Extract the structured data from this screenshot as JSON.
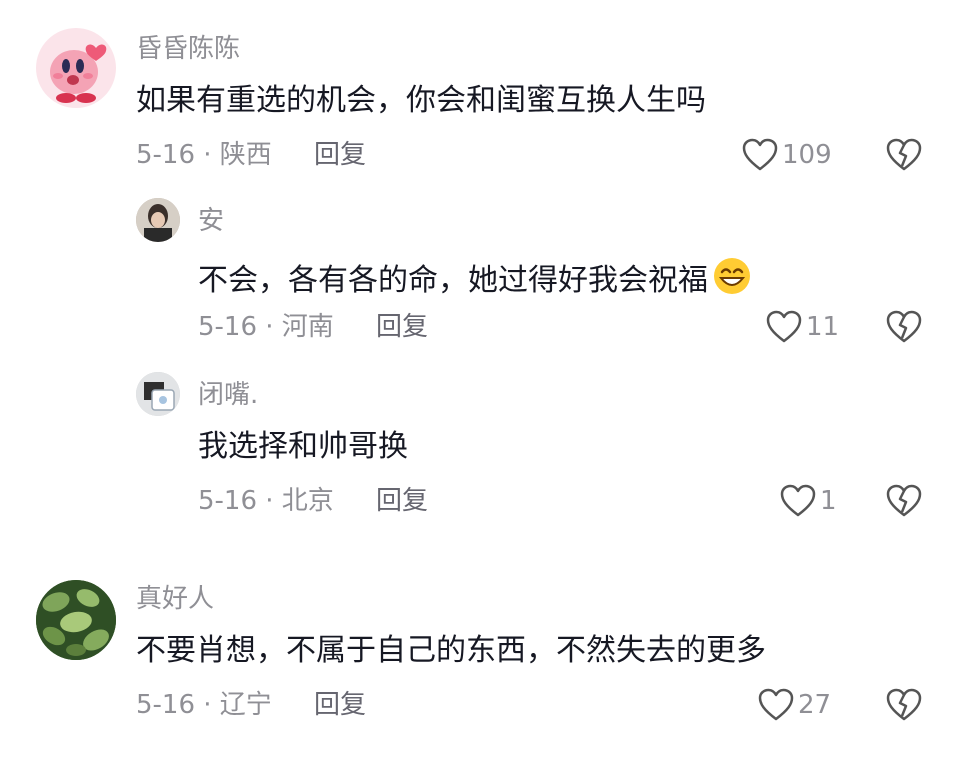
{
  "comments": [
    {
      "username": "昏昏陈陈",
      "text": "如果有重选的机会，你会和闺蜜互换人生吗",
      "date_location": "5-16 · 陕西",
      "reply_label": "回复",
      "likes": "109",
      "avatar_icon": "kirby-avatar-icon"
    },
    {
      "username": "安",
      "text": "不会，各有各的命，她过得好我会祝福",
      "emoji": "grinning-emoji",
      "date_location": "5-16 · 河南",
      "reply_label": "回复",
      "likes": "11",
      "avatar_icon": "photo-avatar-icon"
    },
    {
      "username": "闭嘴.",
      "text": "我选择和帅哥换",
      "date_location": "5-16 · 北京",
      "reply_label": "回复",
      "likes": "1",
      "avatar_icon": "photo-avatar-icon"
    },
    {
      "username": "真好人",
      "text": "不要肖想，不属于自己的东西，不然失去的更多",
      "date_location": "5-16 · 辽宁",
      "reply_label": "回复",
      "likes": "27",
      "avatar_icon": "plant-avatar-icon"
    }
  ],
  "colors": {
    "text": "#161823",
    "muted": "#8f8f95",
    "kirby_pink": "#f4a3b5"
  }
}
